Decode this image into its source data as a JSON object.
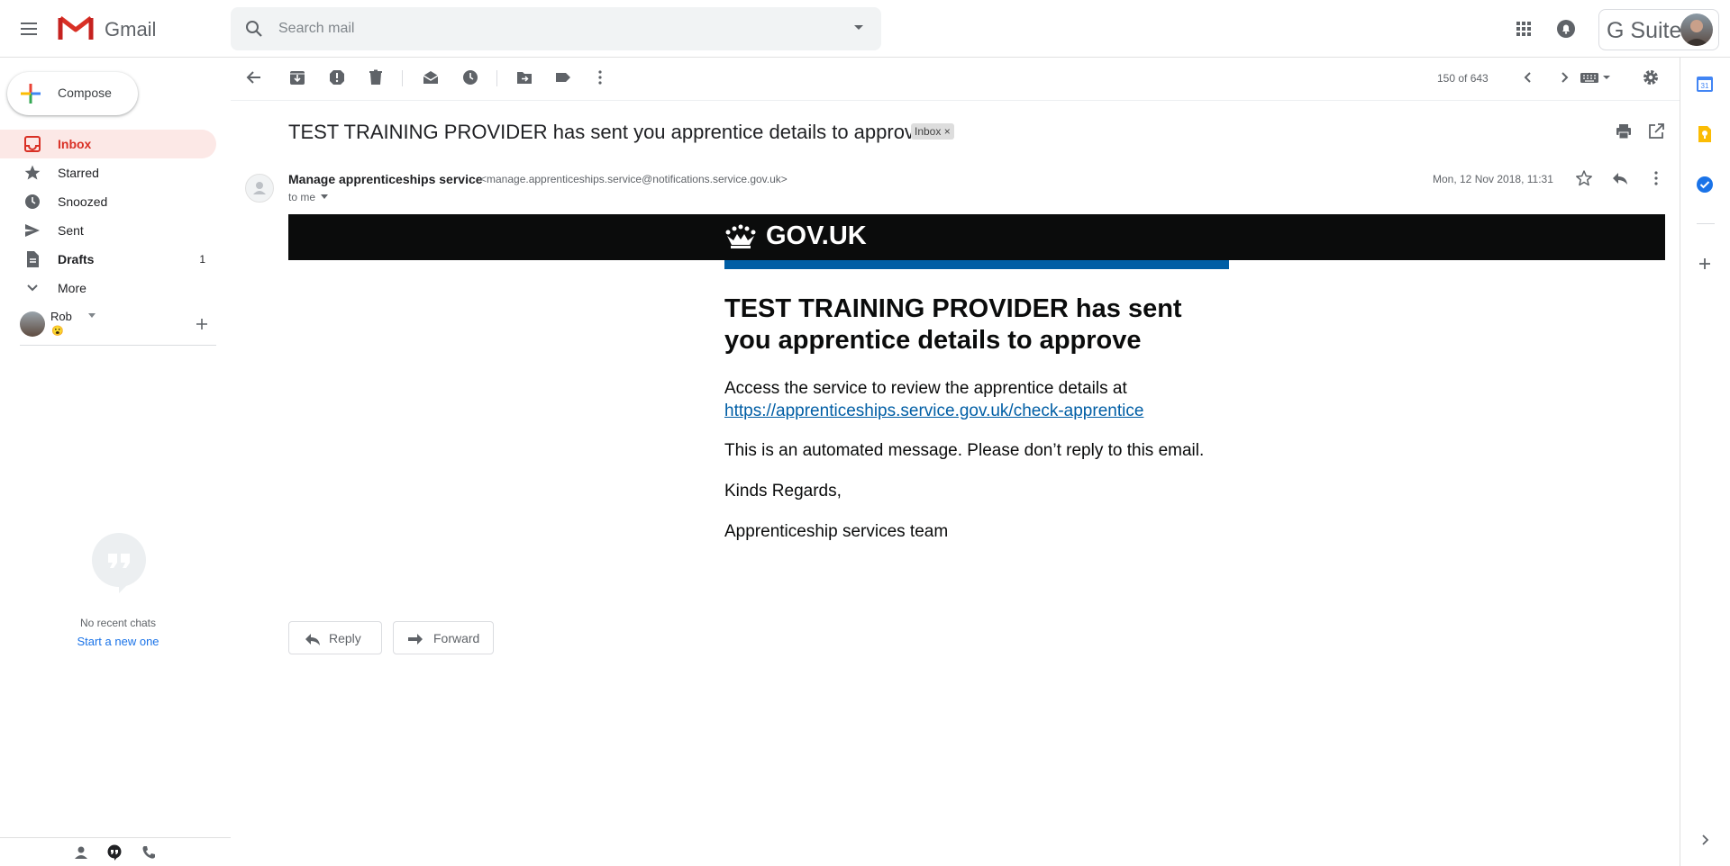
{
  "app": {
    "name": "Gmail",
    "search_placeholder": "Search mail",
    "suite_label": "G Suite"
  },
  "compose_label": "Compose",
  "nav": [
    {
      "label": "Inbox",
      "icon": "inbox-icon",
      "count": "",
      "active": true
    },
    {
      "label": "Starred",
      "icon": "star-icon",
      "count": ""
    },
    {
      "label": "Snoozed",
      "icon": "clock-icon",
      "count": ""
    },
    {
      "label": "Sent",
      "icon": "send-icon",
      "count": ""
    },
    {
      "label": "Drafts",
      "icon": "draft-icon",
      "count": "1"
    },
    {
      "label": "More",
      "icon": "chevron-down-icon",
      "count": ""
    }
  ],
  "hangouts": {
    "user_name": "Rob",
    "status_emoji": "😮",
    "no_chats": "No recent chats",
    "start_new": "Start a new one"
  },
  "toolbar": {
    "pager": "150 of 643"
  },
  "message": {
    "subject": "TEST TRAINING PROVIDER has sent you apprentice details to approve",
    "label_badge": "Inbox",
    "label_badge_close": "×",
    "sender_name": "Manage apprenticeships service",
    "sender_email": "<manage.apprenticeships.service@notifications.service.gov.uk>",
    "recipient": "to me",
    "date": "Mon, 12 Nov 2018, 11:31"
  },
  "email_body": {
    "brand": "GOV.UK",
    "heading": "TEST TRAINING PROVIDER has sent you apprentice details to approve",
    "p1": "Access the service to review the apprentice details at",
    "link": "https://apprenticeships.service.gov.uk/check-apprentice",
    "p2": "This is an automated message. Please don’t reply to this email.",
    "p3": "Kinds Regards,",
    "p4": "Apprenticeship services team"
  },
  "actions": {
    "reply": "Reply",
    "forward": "Forward"
  },
  "colors": {
    "gmail_red": "#d93025",
    "active_bg": "#fce8e6",
    "govuk_black": "#0b0c0c",
    "govuk_blue": "#005ea5",
    "link_blue": "#1a73e8"
  }
}
